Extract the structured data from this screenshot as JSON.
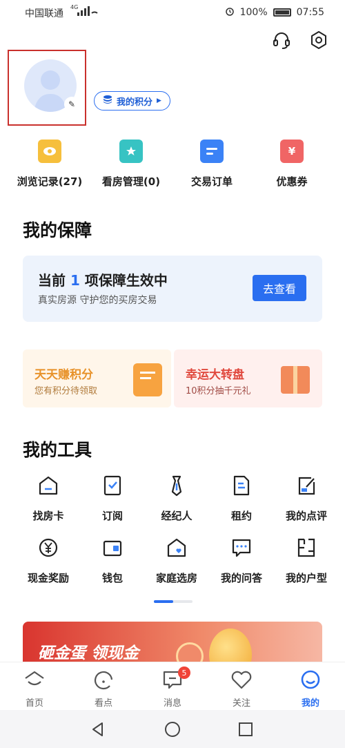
{
  "status_bar": {
    "carrier": "中国联通",
    "network": "4G",
    "battery": "100%",
    "time": "07:55"
  },
  "header": {
    "support_icon": "headset-icon",
    "settings_icon": "gear-icon"
  },
  "profile": {
    "points_label": "我的积分"
  },
  "quick_links": [
    {
      "label": "浏览记录(27)",
      "icon": "eye-icon",
      "color": "#f6bf3c"
    },
    {
      "label": "看房管理(0)",
      "icon": "star-folder-icon",
      "color": "#37c3c3"
    },
    {
      "label": "交易订单",
      "icon": "order-icon",
      "color": "#3b82f6"
    },
    {
      "label": "优惠券",
      "icon": "coupon-icon",
      "color": "#f06565"
    }
  ],
  "guarantee": {
    "title": "我的保障",
    "status_prefix": "当前",
    "count": "1",
    "status_suffix": "项保障生效中",
    "subtitle": "真实房源 守护您的买房交易",
    "button": "去查看"
  },
  "promos": [
    {
      "title": "天天赚积分",
      "subtitle": "您有积分待领取"
    },
    {
      "title": "幸运大转盘",
      "subtitle": "10积分抽千元礼"
    }
  ],
  "tools": {
    "title": "我的工具",
    "items": [
      {
        "label": "找房卡"
      },
      {
        "label": "订阅"
      },
      {
        "label": "经纪人"
      },
      {
        "label": "租约"
      },
      {
        "label": "我的点评"
      },
      {
        "label": "现金奖励"
      },
      {
        "label": "钱包"
      },
      {
        "label": "家庭选房"
      },
      {
        "label": "我的问答"
      },
      {
        "label": "我的户型"
      }
    ]
  },
  "banner": {
    "title": "砸金蛋 领现金"
  },
  "tabbar": [
    {
      "label": "首页"
    },
    {
      "label": "看点"
    },
    {
      "label": "消息",
      "badge": "5"
    },
    {
      "label": "关注"
    },
    {
      "label": "我的",
      "active": true
    }
  ]
}
